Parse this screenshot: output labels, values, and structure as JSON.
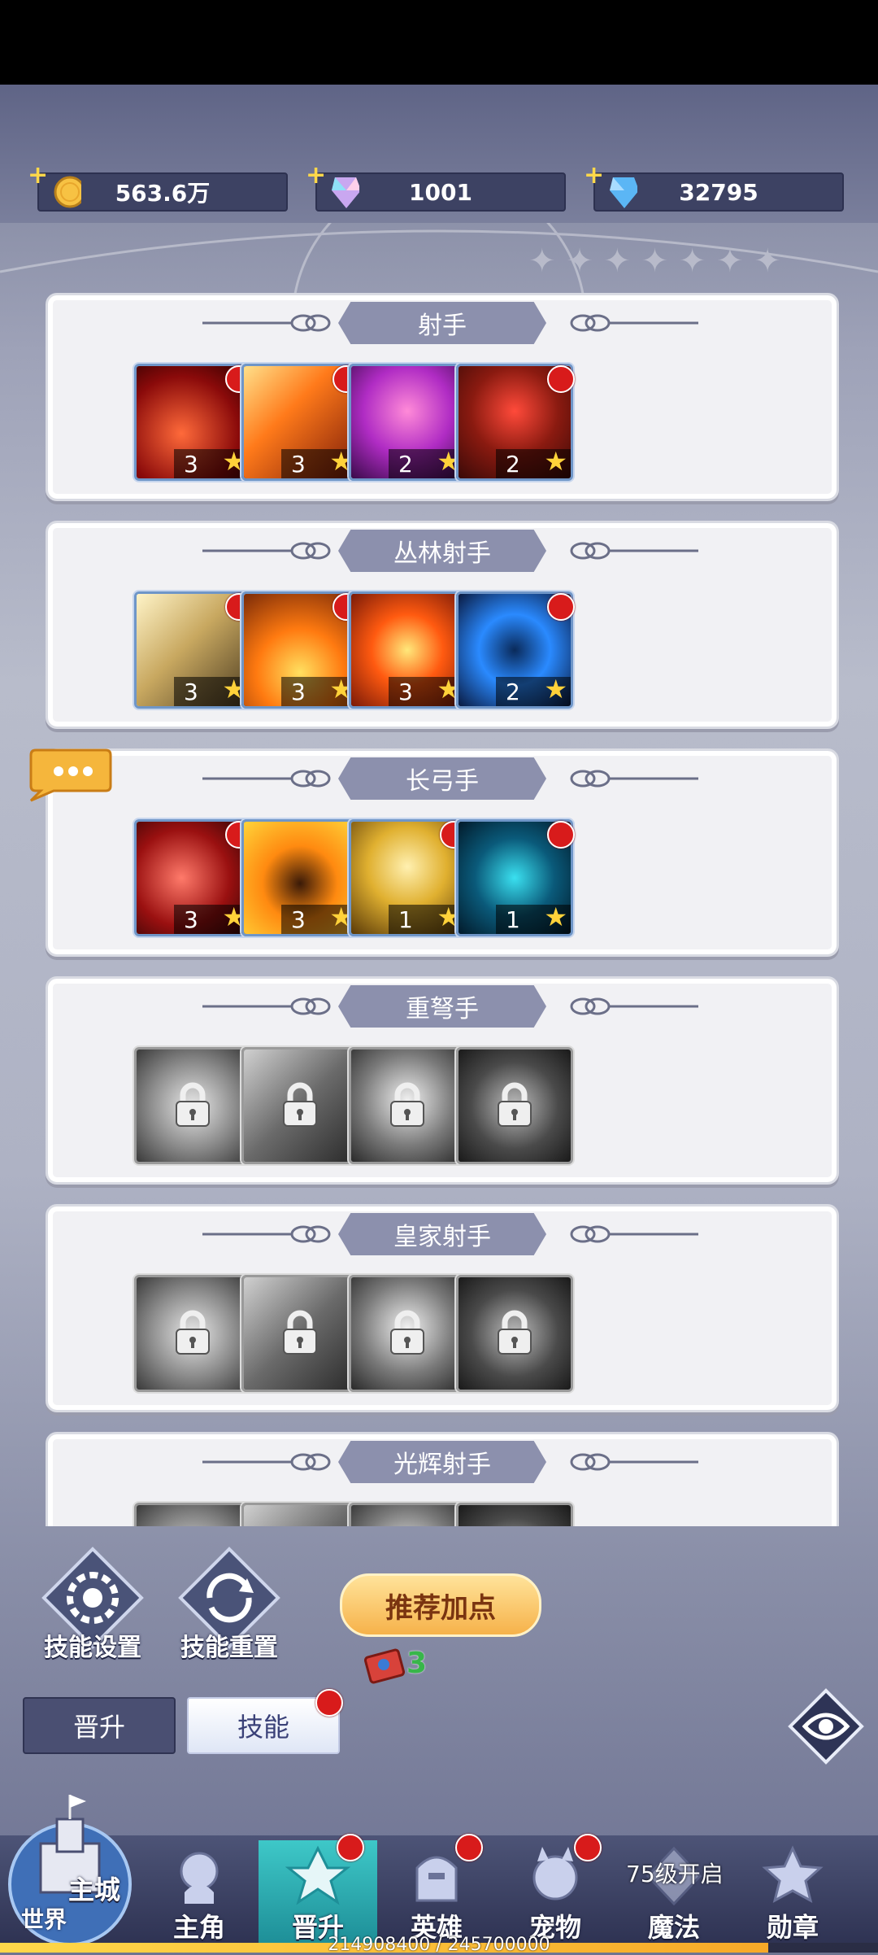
{
  "resources": [
    {
      "value": "563.6万",
      "icon": "gold-coin-icon"
    },
    {
      "value": "1001",
      "icon": "rainbow-crystal-icon"
    },
    {
      "value": "32795",
      "icon": "blue-diamond-icon"
    }
  ],
  "classes": [
    {
      "name": "射手",
      "skills": [
        {
          "level": "3",
          "art": "red-arrows",
          "dot": true
        },
        {
          "level": "3",
          "art": "fire-streaks",
          "dot": true
        },
        {
          "level": "2",
          "art": "purple-archer",
          "dot": false
        },
        {
          "level": "2",
          "art": "blood-burst",
          "dot": true
        }
      ]
    },
    {
      "name": "丛林射手",
      "skills": [
        {
          "level": "3",
          "art": "golden-spikes",
          "dot": true
        },
        {
          "level": "3",
          "art": "fire-rain",
          "dot": true
        },
        {
          "level": "3",
          "art": "fire-explosion",
          "dot": false
        },
        {
          "level": "2",
          "art": "blue-aura",
          "dot": true
        }
      ]
    },
    {
      "name": "长弓手",
      "skills": [
        {
          "level": "3",
          "art": "flame-arrow",
          "dot": true
        },
        {
          "level": "3",
          "art": "burning-man",
          "dot": false
        },
        {
          "level": "1",
          "art": "golden-strike",
          "dot": true
        },
        {
          "level": "1",
          "art": "cyan-spirit",
          "dot": true
        }
      ]
    },
    {
      "name": "重弩手",
      "locked": true
    },
    {
      "name": "皇家射手",
      "locked": true
    },
    {
      "name": "光辉射手",
      "locked": true
    }
  ],
  "actions": {
    "skill_settings": "技能设置",
    "skill_reset": "技能重置",
    "recommend": "推荐加点",
    "points": "3"
  },
  "tabs": {
    "promote": "晋升",
    "skill": "技能"
  },
  "nav": {
    "city": "主城",
    "world": "世界",
    "items": [
      {
        "label": "主角",
        "dot": false
      },
      {
        "label": "晋升",
        "dot": true,
        "active": true
      },
      {
        "label": "英雄",
        "dot": true
      },
      {
        "label": "宠物",
        "dot": true
      },
      {
        "label": "魔法",
        "dot": false
      },
      {
        "label": "勋章",
        "dot": false
      }
    ],
    "magic_unlock": "75级开启"
  },
  "progress": {
    "text": "214908400 / 245700000",
    "fraction": 0.8747
  },
  "colors": {
    "accent_gold": "#ffd23a",
    "red_dot": "#d81b1b",
    "tab_active_teal": "#3ec8c8"
  }
}
